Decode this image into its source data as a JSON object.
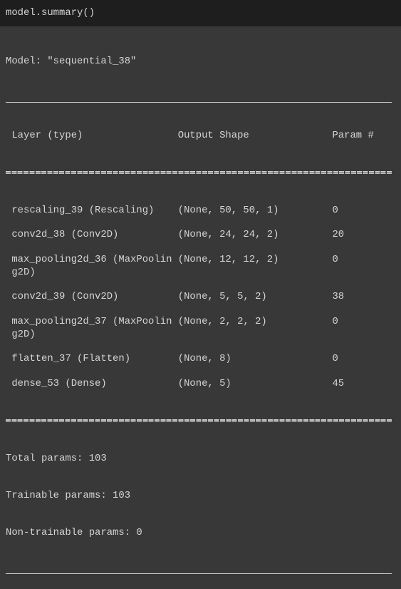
{
  "cell": {
    "code": "model.summary()"
  },
  "summary": {
    "model_line": "Model: \"sequential_38\"",
    "headers": {
      "layer": " Layer (type)",
      "shape": "Output Shape",
      "params": "Param #"
    },
    "rows": [
      {
        "layer": " rescaling_39 (Rescaling)",
        "layer_cont": null,
        "shape": "(None, 50, 50, 1)",
        "params": "0"
      },
      {
        "layer": " conv2d_38 (Conv2D)",
        "layer_cont": null,
        "shape": "(None, 24, 24, 2)",
        "params": "20"
      },
      {
        "layer": " max_pooling2d_36 (MaxPoolin",
        "layer_cont": " g2D)",
        "shape": "(None, 12, 12, 2)",
        "params": "0"
      },
      {
        "layer": " conv2d_39 (Conv2D)",
        "layer_cont": null,
        "shape": "(None, 5, 5, 2)",
        "params": "38"
      },
      {
        "layer": " max_pooling2d_37 (MaxPoolin",
        "layer_cont": " g2D)",
        "shape": "(None, 2, 2, 2)",
        "params": "0"
      },
      {
        "layer": " flatten_37 (Flatten)",
        "layer_cont": null,
        "shape": "(None, 8)",
        "params": "0"
      },
      {
        "layer": " dense_53 (Dense)",
        "layer_cont": null,
        "shape": "(None, 5)",
        "params": "45"
      }
    ],
    "total": "Total params: 103",
    "trainable": "Trainable params: 103",
    "non_trainable": "Non-trainable params: 0"
  }
}
